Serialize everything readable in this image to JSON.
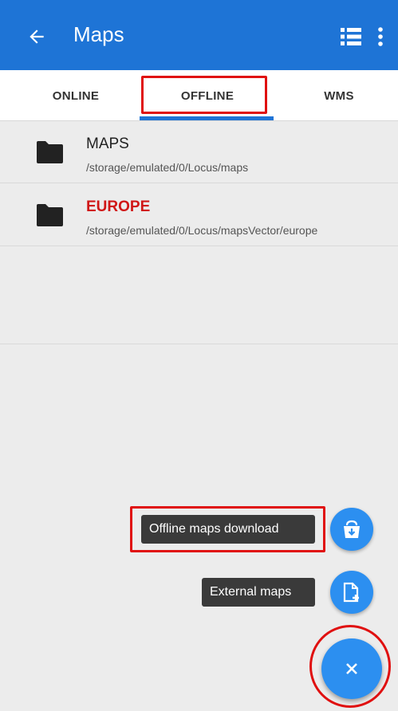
{
  "appbar": {
    "title": "Maps",
    "back_icon": "arrow-left-icon",
    "list_icon": "list-view-icon",
    "more_icon": "more-vert-icon",
    "color": "#1e74d6"
  },
  "tabs": [
    {
      "label": "ONLINE",
      "selected": false
    },
    {
      "label": "OFFLINE",
      "selected": true
    },
    {
      "label": "WMS",
      "selected": false
    }
  ],
  "folders": [
    {
      "name": "MAPS",
      "path": "/storage/emulated/0/Locus/maps",
      "icon": "folder-icon"
    },
    {
      "name": "EUROPE",
      "path": "/storage/emulated/0/Locus/mapsVector/europe",
      "icon": "folder-icon",
      "name_color": "#d01818"
    }
  ],
  "fab_menu": {
    "items": [
      {
        "label": "Offline maps download",
        "icon": "shop-download-icon"
      },
      {
        "label": "External maps",
        "icon": "add-file-icon"
      }
    ],
    "main_icon": "close-icon"
  },
  "colors": {
    "accent": "#2c8ff0",
    "highlight": "#e01010"
  }
}
